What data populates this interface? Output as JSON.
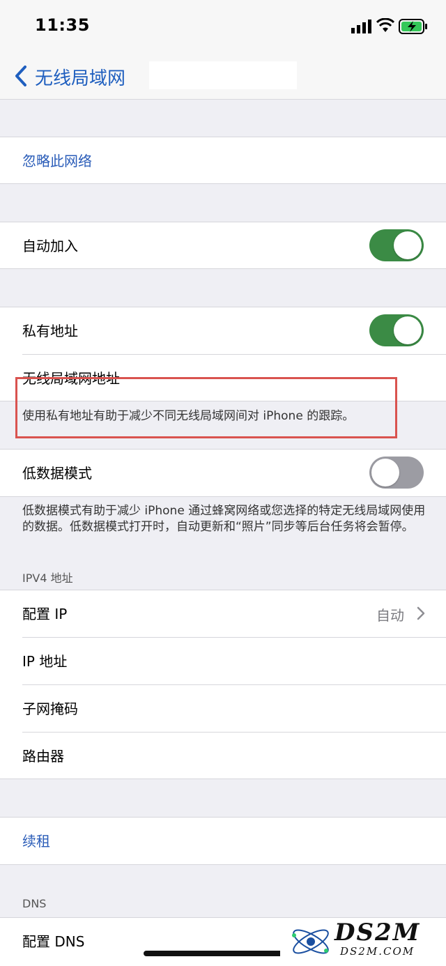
{
  "status_bar": {
    "time": "11:35"
  },
  "nav": {
    "back_label": "无线局域网"
  },
  "forget": {
    "label": "忽略此网络"
  },
  "auto_join": {
    "label": "自动加入",
    "on": true
  },
  "private_address": {
    "label": "私有地址",
    "on": true,
    "wifi_address_label": "无线局域网地址",
    "footer": "使用私有地址有助于减少不同无线局域网间对 iPhone 的跟踪。"
  },
  "low_data": {
    "label": "低数据模式",
    "on": false,
    "footer": "低数据模式有助于减少 iPhone 通过蜂窝网络或您选择的特定无线局域网使用的数据。低数据模式打开时，自动更新和“照片”同步等后台任务将会暂停。"
  },
  "ipv4": {
    "header": "IPV4 地址",
    "configure_ip_label": "配置 IP",
    "configure_ip_value": "自动",
    "ip_address_label": "IP 地址",
    "subnet_label": "子网掩码",
    "router_label": "路由器"
  },
  "renew": {
    "label": "续租"
  },
  "dns": {
    "header": "DNS",
    "configure_label": "配置 DNS"
  },
  "watermark": {
    "main": "DS2M",
    "sub": "DS2M.COM"
  },
  "colors": {
    "accent": "#2a5cb8",
    "toggle_on": "#3b8b45",
    "highlight": "#d9534f"
  }
}
